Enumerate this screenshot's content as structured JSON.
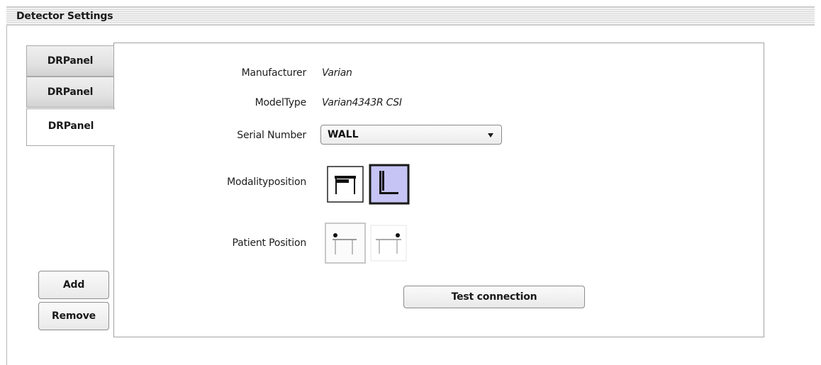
{
  "window": {
    "title": "Detector Settings"
  },
  "tabs": [
    {
      "label": "DRPanel",
      "active": false
    },
    {
      "label": "DRPanel",
      "active": false
    },
    {
      "label": "DRPanel",
      "active": true
    }
  ],
  "form": {
    "manufacturer": {
      "label": "Manufacturer",
      "value": "Varian"
    },
    "model_type": {
      "label": "ModelType",
      "value": "Varian4343R CSI"
    },
    "serial_number": {
      "label": "Serial Number",
      "selected": "WALL"
    },
    "modality_position": {
      "label": "Modalityposition",
      "options": [
        {
          "icon": "table-icon",
          "selected": false
        },
        {
          "icon": "wall-stand-icon",
          "selected": true
        }
      ]
    },
    "patient_position": {
      "label": "Patient Position",
      "options": [
        {
          "icon": "head-left-table-icon",
          "selected": true
        },
        {
          "icon": "head-right-table-icon",
          "selected": false
        }
      ]
    }
  },
  "buttons": {
    "add": "Add",
    "remove": "Remove",
    "test_connection": "Test connection"
  },
  "colors": {
    "selected_icon_bg": "#c6c4f4",
    "selected_icon_border": "#1a1a1a"
  }
}
